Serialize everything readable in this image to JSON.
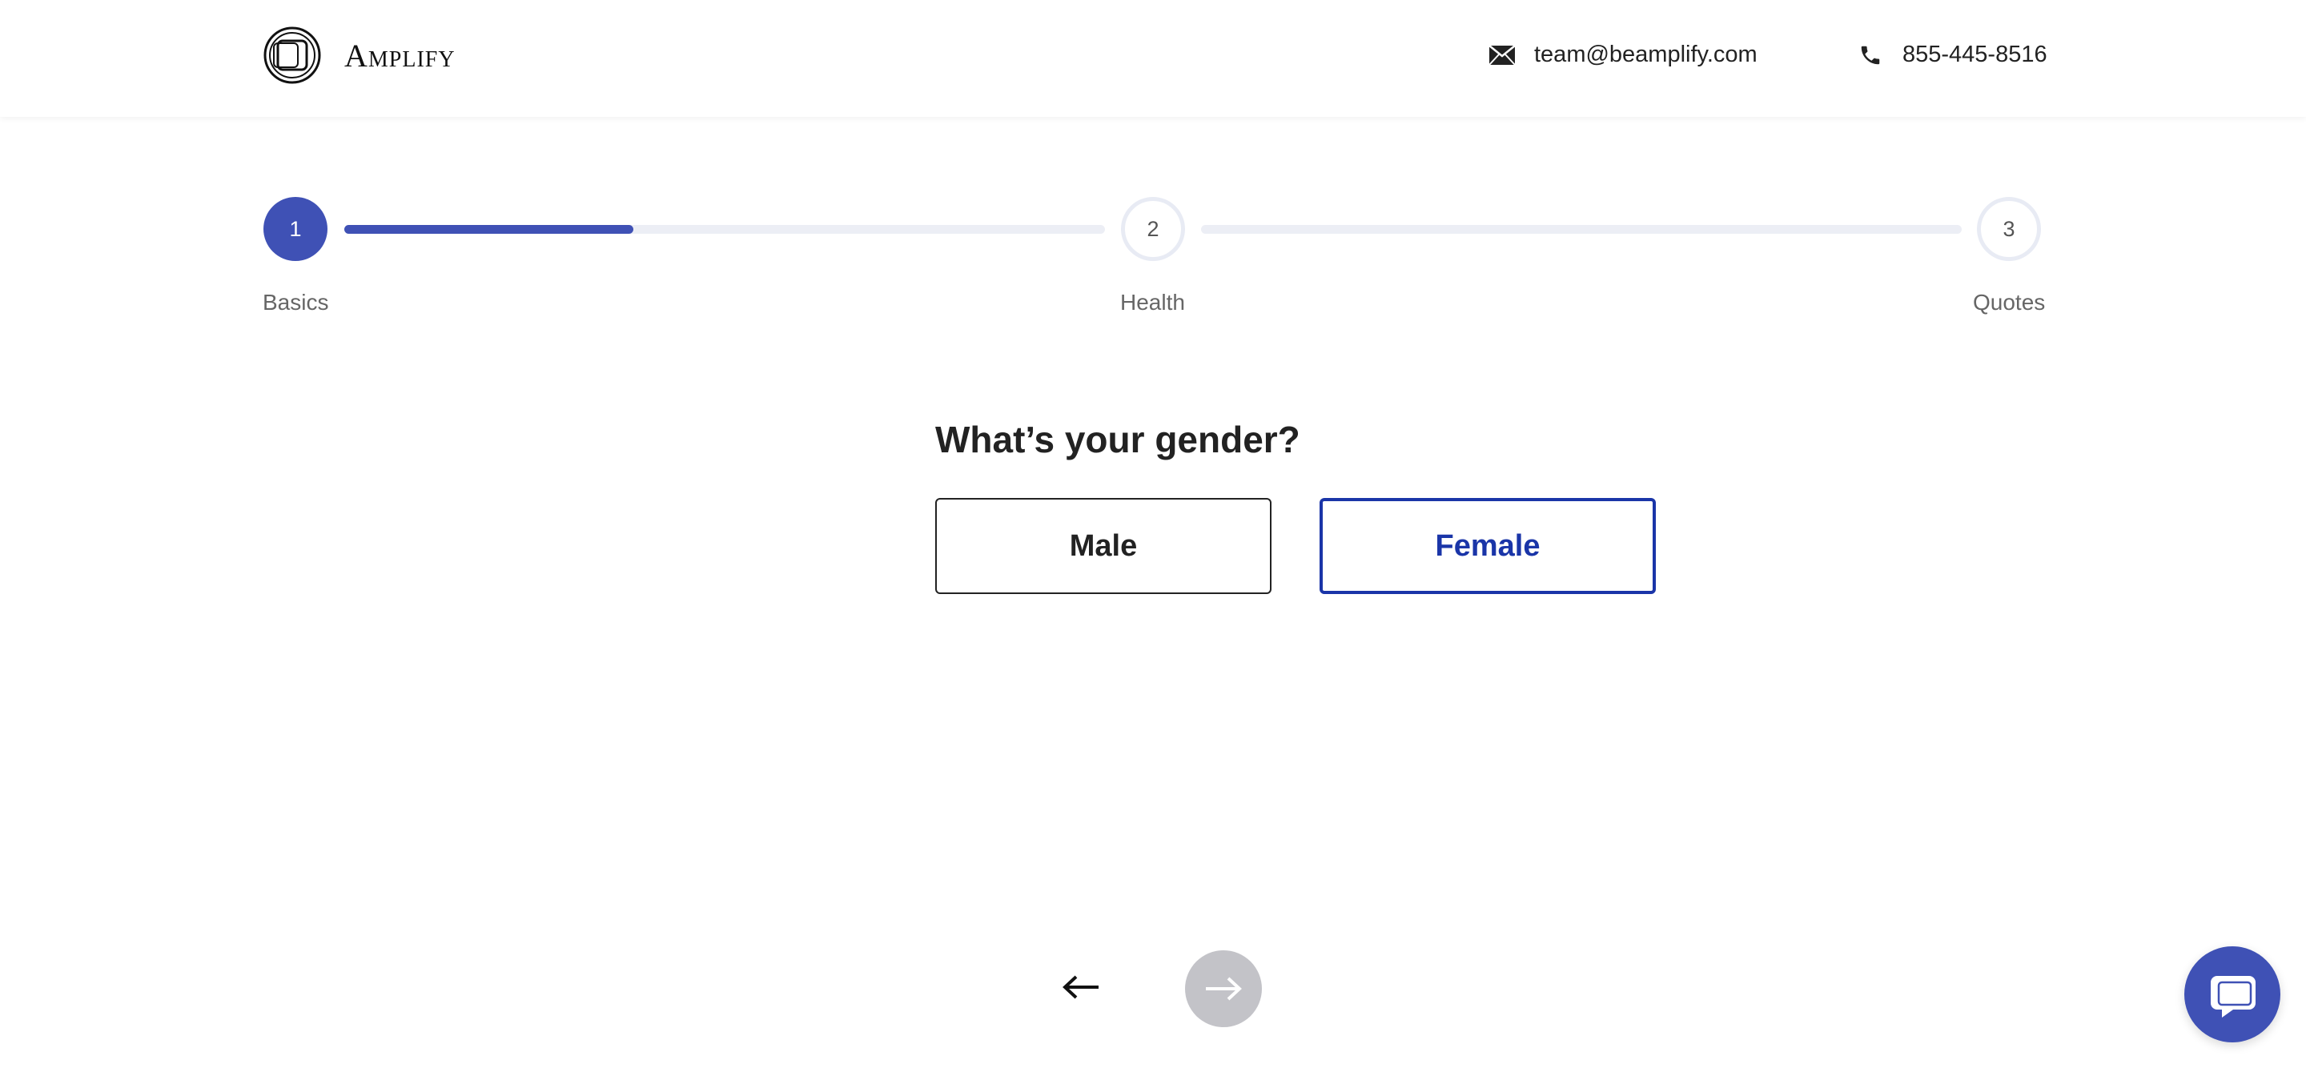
{
  "header": {
    "brand": "Amplify",
    "email": "team@beamplify.com",
    "phone": "855-445-8516"
  },
  "stepper": {
    "steps": [
      {
        "number": "1",
        "label": "Basics",
        "state": "active"
      },
      {
        "number": "2",
        "label": "Health",
        "state": "inactive"
      },
      {
        "number": "3",
        "label": "Quotes",
        "state": "inactive"
      }
    ],
    "progress_segment_1": 0.38,
    "progress_segment_2": 0
  },
  "question": {
    "title": "What’s your gender?",
    "options": [
      {
        "label": "Male",
        "selected": false
      },
      {
        "label": "Female",
        "selected": true
      }
    ]
  },
  "colors": {
    "accent": "#3f51b5",
    "selected_border": "#1a35a8",
    "track": "#eceef5",
    "next_disabled": "#c3c3c8"
  },
  "icons": {
    "email": "envelope-icon",
    "phone": "phone-icon",
    "back": "arrow-left-icon",
    "next": "arrow-right-icon",
    "chat": "chat-icon"
  }
}
